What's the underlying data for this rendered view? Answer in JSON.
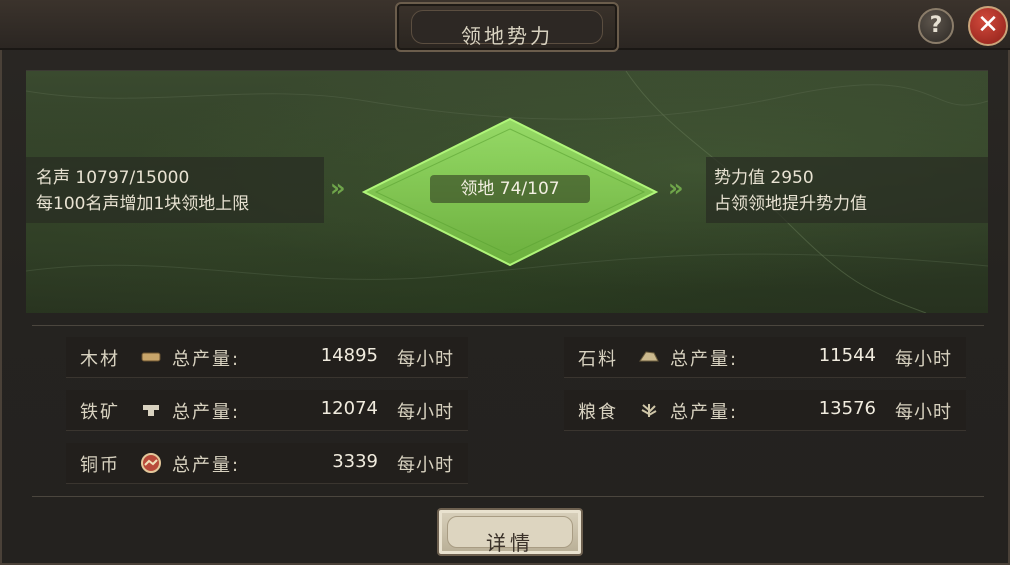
{
  "window": {
    "title": "领地势力",
    "help_label": "?",
    "close_label": "✕"
  },
  "map": {
    "left": {
      "line1": "名声 10797/15000",
      "line2": "每100名声增加1块领地上限"
    },
    "center": {
      "label": "领地 74/107"
    },
    "right": {
      "line1": "势力值 2950",
      "line2": "占领领地提升势力值"
    },
    "accent_color": "#7fd24a"
  },
  "resources": [
    {
      "name": "木材",
      "icon": "wood-icon",
      "total_label": "总产量:",
      "value": "14895",
      "unit": "每小时"
    },
    {
      "name": "石料",
      "icon": "stone-icon",
      "total_label": "总产量:",
      "value": "11544",
      "unit": "每小时"
    },
    {
      "name": "铁矿",
      "icon": "iron-icon",
      "total_label": "总产量:",
      "value": "12074",
      "unit": "每小时"
    },
    {
      "name": "粮食",
      "icon": "grain-icon",
      "total_label": "总产量:",
      "value": "13576",
      "unit": "每小时"
    },
    {
      "name": "铜币",
      "icon": "coin-icon",
      "total_label": "总产量:",
      "value": "3339",
      "unit": "每小时"
    }
  ],
  "detail_button": {
    "label": "详情"
  }
}
